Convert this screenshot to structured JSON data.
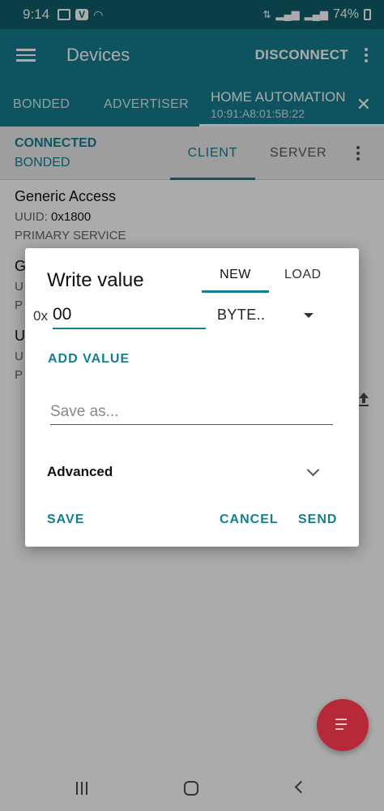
{
  "status_bar": {
    "time": "9:14",
    "battery": "74%"
  },
  "app_bar": {
    "title": "Devices",
    "disconnect_label": "DISCONNECT"
  },
  "device_tabs": {
    "bonded": "BONDED",
    "advertiser": "ADVERTISER",
    "active_name": "HOME AUTOMATION",
    "active_address": "10:91:A8:01:5B:22"
  },
  "connection": {
    "state": "CONNECTED",
    "bond_state": "BONDED",
    "tab_client": "CLIENT",
    "tab_server": "SERVER"
  },
  "services": [
    {
      "name": "Generic Access",
      "uuid_label": "UUID:",
      "uuid": "0x1800",
      "type": "PRIMARY SERVICE"
    },
    {
      "name": "G",
      "uuid_label": "U",
      "type": "P"
    },
    {
      "name": "U",
      "uuid_label": "U",
      "type": "P"
    }
  ],
  "dialog": {
    "title": "Write value",
    "tab_new": "NEW",
    "tab_load": "LOAD",
    "hex_prefix": "0x",
    "value": "00",
    "format": "BYTE..",
    "add_value": "ADD VALUE",
    "save_as_placeholder": "Save as...",
    "advanced": "Advanced",
    "save": "SAVE",
    "cancel": "CANCEL",
    "send": "SEND"
  },
  "colors": {
    "status_bar": "#0f5e6c",
    "primary": "#157e8f",
    "accent": "#b71c2c"
  }
}
